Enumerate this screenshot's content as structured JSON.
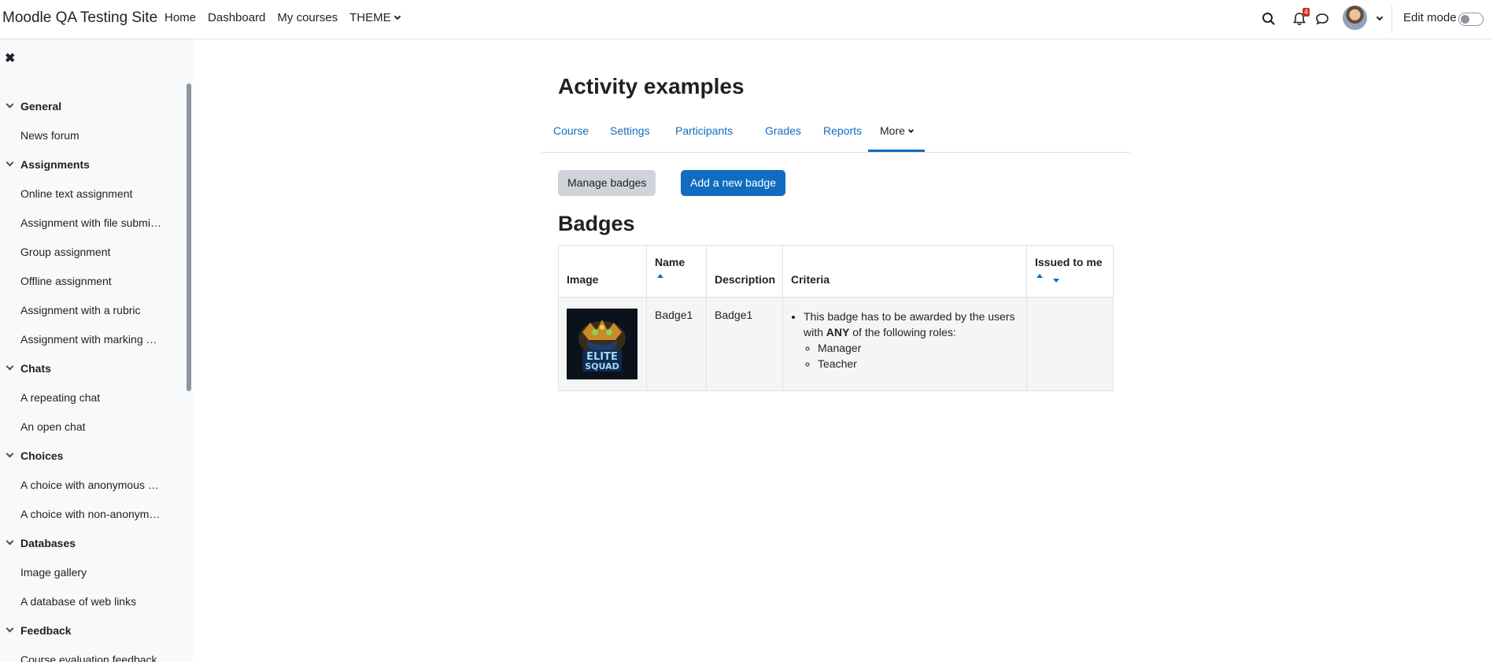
{
  "site": {
    "name": "Moodle QA Testing Site"
  },
  "primary_nav": [
    {
      "label": "Home"
    },
    {
      "label": "Dashboard"
    },
    {
      "label": "My courses"
    },
    {
      "label": "THEME"
    }
  ],
  "navbar": {
    "notification_count": "4",
    "edit_mode_label": "Edit mode",
    "edit_mode_on": false,
    "icons": [
      "search-icon",
      "bell-icon",
      "chat-icon"
    ]
  },
  "course_index": {
    "sections": [
      {
        "title": "General",
        "items": [
          "News forum"
        ]
      },
      {
        "title": "Assignments",
        "items": [
          "Online text assignment",
          "Assignment with file submi…",
          "Group assignment",
          "Offline assignment",
          "Assignment with a rubric",
          "Assignment with marking …"
        ]
      },
      {
        "title": "Chats",
        "items": [
          "A repeating chat",
          "An open chat"
        ]
      },
      {
        "title": "Choices",
        "items": [
          "A choice with anonymous …",
          "A choice with non-anonym…"
        ]
      },
      {
        "title": "Databases",
        "items": [
          "Image gallery",
          "A database of web links"
        ]
      },
      {
        "title": "Feedback",
        "items": [
          "Course evaluation feedback"
        ]
      }
    ]
  },
  "page": {
    "title": "Activity examples",
    "tabs": [
      {
        "label": "Course"
      },
      {
        "label": "Settings"
      },
      {
        "label": "Participants"
      },
      {
        "label": "Grades"
      },
      {
        "label": "Reports"
      },
      {
        "label": "More"
      }
    ],
    "active_tab": "More",
    "buttons": {
      "manage": "Manage badges",
      "add": "Add a new badge"
    },
    "section_title": "Badges"
  },
  "table": {
    "headers": {
      "image": "Image",
      "name": "Name",
      "description": "Description",
      "criteria": "Criteria",
      "issued": "Issued to me"
    },
    "rows": [
      {
        "image_text": "ELITE SQUAD",
        "name": "Badge1",
        "description": "Badge1",
        "criteria_prefix": "This badge has to be awarded by the users with ",
        "criteria_strong": "ANY",
        "criteria_suffix": " of the following roles:",
        "roles": [
          "Manager",
          "Teacher"
        ],
        "issued": ""
      }
    ]
  },
  "colors": {
    "link": "#0f6cbf",
    "primary_button": "#0f6cbf",
    "secondary_button": "#ced4da",
    "drawer_bg": "#f8f9fa",
    "notification": "#ca3120"
  }
}
